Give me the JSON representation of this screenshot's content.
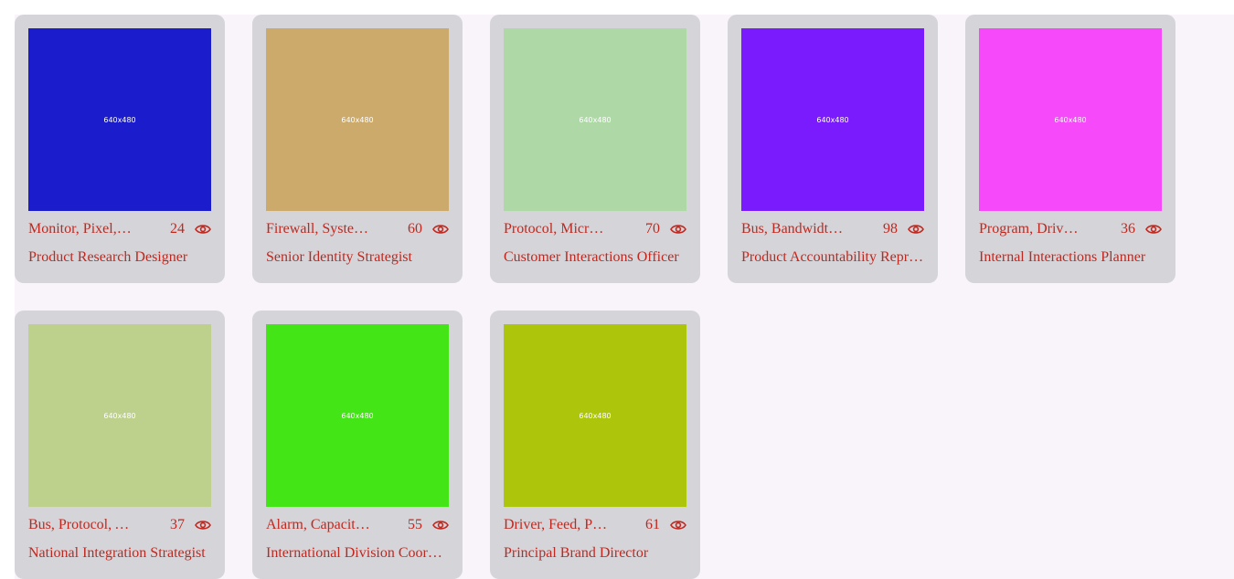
{
  "cards": [
    {
      "image_label": "640x480",
      "image_color": "#1b1ccc",
      "tags": "Monitor, Pixel, Capacitor",
      "views": "24",
      "title": "Product Research Designer"
    },
    {
      "image_label": "640x480",
      "image_color": "#cbaa6c",
      "tags": "Firewall, System, Card",
      "views": "60",
      "title": "Senior Identity Strategist"
    },
    {
      "image_label": "640x480",
      "image_color": "#aed9a7",
      "tags": "Protocol, Microchip, Feed",
      "views": "70",
      "title": "Customer Interactions Officer"
    },
    {
      "image_label": "640x480",
      "image_color": "#7a1bfd",
      "tags": "Bus, Bandwidth, Port",
      "views": "98",
      "title": "Product Accountability Representative"
    },
    {
      "image_label": "640x480",
      "image_color": "#f649f9",
      "tags": "Program, Driver, Pixel",
      "views": "36",
      "title": "Internal Interactions Planner"
    },
    {
      "image_label": "640x480",
      "image_color": "#bdd08c",
      "tags": "Bus, Protocol, Array",
      "views": "37",
      "title": "National Integration Strategist"
    },
    {
      "image_label": "640x480",
      "image_color": "#43e517",
      "tags": "Alarm, Capacitor, Card",
      "views": "55",
      "title": "International Division Coordinator"
    },
    {
      "image_label": "640x480",
      "image_color": "#adc50b",
      "tags": "Driver, Feed, Panel",
      "views": "61",
      "title": "Principal Brand Director"
    }
  ],
  "colors": {
    "text_accent": "#c0281f",
    "card_bg": "#d5d4d8",
    "page_bg": "#f8f4f9"
  },
  "icons": {
    "views": "eye-icon"
  }
}
